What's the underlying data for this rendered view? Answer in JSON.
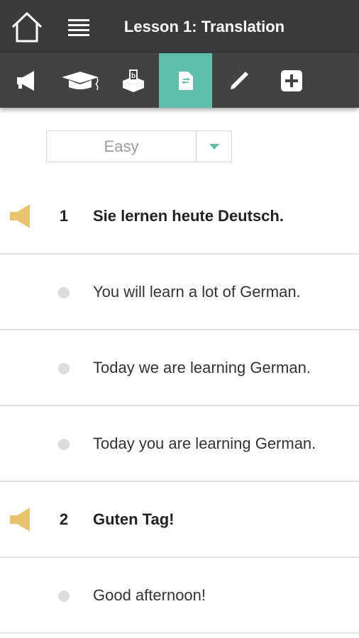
{
  "header": {
    "title": "Lesson 1: Translation",
    "home_icon": "home-icon",
    "menu_icon": "hamburger-menu-icon"
  },
  "toolbar": {
    "tools": [
      {
        "name": "listen",
        "icon": "megaphone-icon",
        "active": false
      },
      {
        "name": "learn",
        "icon": "graduation-cap-icon",
        "active": false
      },
      {
        "name": "vocabulary",
        "icon": "vocabulary-box-icon",
        "active": false
      },
      {
        "name": "translation",
        "icon": "document-swap-icon",
        "active": true
      },
      {
        "name": "write",
        "icon": "pencil-icon",
        "active": false
      },
      {
        "name": "add",
        "icon": "plus-box-icon",
        "active": false
      }
    ],
    "active_color": "#5bbfa9"
  },
  "difficulty": {
    "selected": "Easy"
  },
  "items": [
    {
      "type": "question",
      "number": "1",
      "text": "Sie lernen heute Deutsch."
    },
    {
      "type": "answer",
      "text": "You will learn a lot of German."
    },
    {
      "type": "answer",
      "text": "Today we are learning German."
    },
    {
      "type": "answer",
      "text": "Today you are learning German."
    },
    {
      "type": "question",
      "number": "2",
      "text": "Guten Tag!"
    },
    {
      "type": "answer",
      "text": "Good afternoon!"
    }
  ],
  "colors": {
    "speaker": "#e8c46e",
    "accent": "#5bbfa9",
    "header_bg": "#3a3a3a"
  }
}
